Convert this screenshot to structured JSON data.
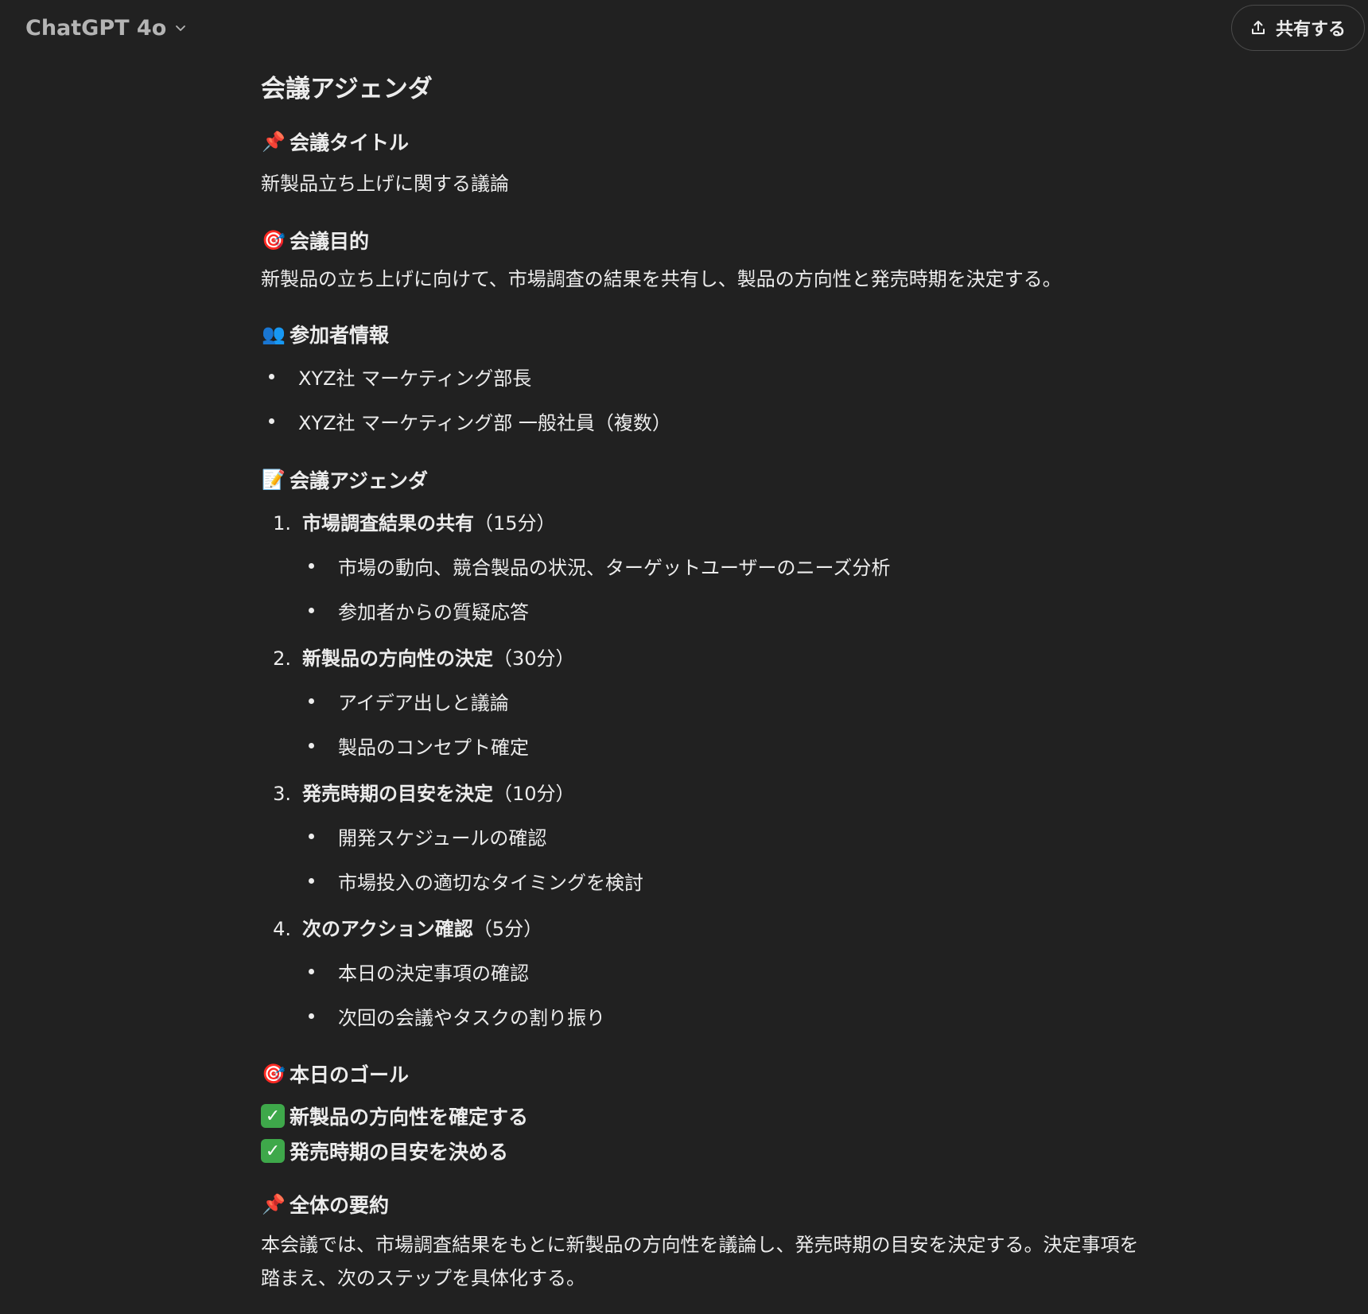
{
  "header": {
    "model_name": "ChatGPT 4o",
    "share_label": "共有する"
  },
  "doc": {
    "title": "会議アジェンダ",
    "sections": {
      "meeting_title": {
        "emoji": "📌",
        "heading": "会議タイトル",
        "body": "新製品立ち上げに関する議論"
      },
      "purpose": {
        "emoji": "🎯",
        "heading": "会議目的",
        "body": "新製品の立ち上げに向けて、市場調査の結果を共有し、製品の方向性と発売時期を決定する。"
      },
      "participants": {
        "emoji": "👥",
        "heading": "参加者情報",
        "items": [
          "XYZ社 マーケティング部長",
          "XYZ社 マーケティング部 一般社員（複数）"
        ]
      },
      "agenda": {
        "emoji": "📝",
        "heading": "会議アジェンダ",
        "items": [
          {
            "num": "1.",
            "title": "市場調査結果の共有",
            "time": "（15分）",
            "subitems": [
              "市場の動向、競合製品の状況、ターゲットユーザーのニーズ分析",
              "参加者からの質疑応答"
            ]
          },
          {
            "num": "2.",
            "title": "新製品の方向性の決定",
            "time": "（30分）",
            "subitems": [
              "アイデア出しと議論",
              "製品のコンセプト確定"
            ]
          },
          {
            "num": "3.",
            "title": "発売時期の目安を決定",
            "time": "（10分）",
            "subitems": [
              "開発スケジュールの確認",
              "市場投入の適切なタイミングを検討"
            ]
          },
          {
            "num": "4.",
            "title": "次のアクション確認",
            "time": "（5分）",
            "subitems": [
              "本日の決定事項の確認",
              "次回の会議やタスクの割り振り"
            ]
          }
        ]
      },
      "goals": {
        "emoji": "🎯",
        "heading": "本日のゴール",
        "items": [
          "新製品の方向性を確定する",
          "発売時期の目安を決める"
        ]
      },
      "summary": {
        "emoji": "📌",
        "heading": "全体の要約",
        "body_line1": "本会議では、市場調査結果をもとに新製品の方向性を議論し、発売時期の目安を決定する。決定事項を",
        "body_line2": "踏まえ、次のステップを具体化する。"
      }
    }
  }
}
